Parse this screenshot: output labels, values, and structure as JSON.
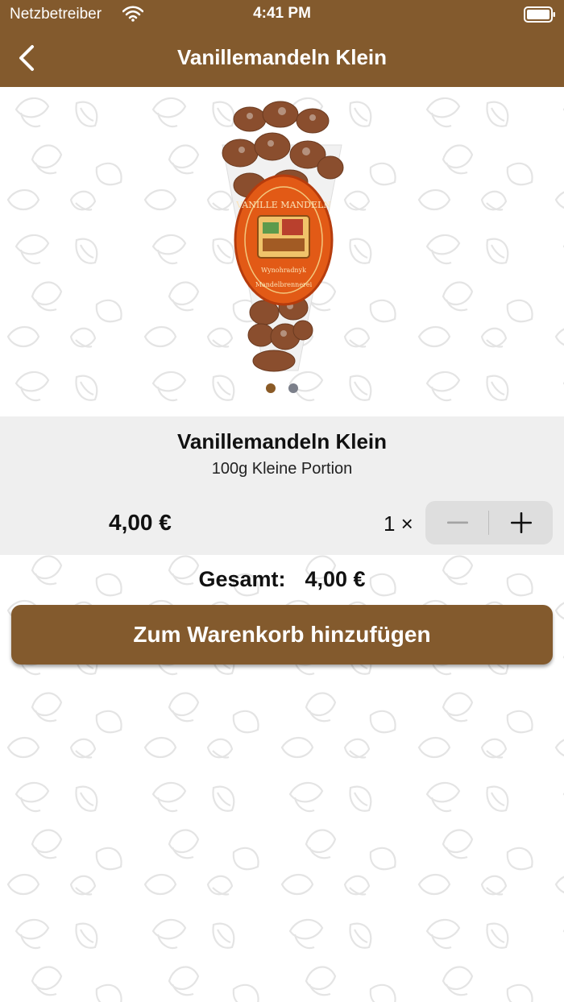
{
  "status_bar": {
    "carrier": "Netzbetreiber",
    "time": "4:41 PM",
    "wifi_icon": "wifi-icon",
    "battery_icon": "battery-icon"
  },
  "nav": {
    "title": "Vanillemandeln Klein",
    "back_icon": "chevron-left-icon"
  },
  "gallery": {
    "image_label": "VANILLE MANDELN",
    "image_sublabel_1": "Wynohradnyk",
    "image_sublabel_2": "Mandelbrennerei",
    "page_count": 2,
    "active_page": 1
  },
  "product": {
    "name": "Vanillemandeln Klein",
    "description": "100g Kleine Portion",
    "price": "4,00 €",
    "quantity": "1 ×"
  },
  "total": {
    "label": "Gesamt:",
    "value": "4,00 €"
  },
  "cart_button": {
    "label": "Zum Warenkorb hinzufügen"
  },
  "colors": {
    "brand_brown": "#835a2d",
    "panel_gray": "#efefef",
    "stepper_gray": "#dedede",
    "dot_active": "#8a5a26",
    "dot_inactive": "#7b7f8a"
  }
}
